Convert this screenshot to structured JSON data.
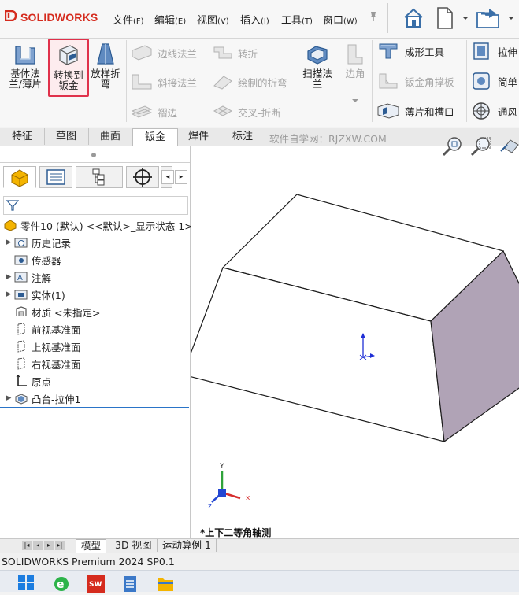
{
  "app": {
    "logo_text": "SOLIDWORKS",
    "brand_color": "#d52b1e"
  },
  "menus": [
    {
      "label": "文件",
      "key": "(F)"
    },
    {
      "label": "编辑",
      "key": "(E)"
    },
    {
      "label": "视图",
      "key": "(V)"
    },
    {
      "label": "插入",
      "key": "(I)"
    },
    {
      "label": "工具",
      "key": "(T)"
    },
    {
      "label": "窗口",
      "key": "(W)"
    }
  ],
  "ribbon": {
    "base_flange": "基体法\n兰/薄片",
    "convert_to_sheet_metal": "转换到\n钣金",
    "lofted_bend": "放样折\n弯",
    "edge_flange": "边线法兰",
    "jog": "转折",
    "miter_flange": "斜接法兰",
    "sketched_bend": "绘制的折弯",
    "hem": "褶边",
    "cross_break": "交叉-折断",
    "swept_flange": "扫描法\n兰",
    "corner": "边角",
    "forming_tool": "成形工具",
    "sheet_metal_gusset": "钣金角撑板",
    "tab_and_slot": "薄片和槽口",
    "extrude": "拉伸",
    "simple": "简单",
    "vent": "通风"
  },
  "tabs": [
    "特征",
    "草图",
    "曲面",
    "钣金",
    "焊件",
    "标注"
  ],
  "active_tab": "钣金",
  "watermark": "软件自学网：RJZXW.COM",
  "tree": {
    "root": "零件10 (默认) <<默认>_显示状态 1>",
    "items": [
      {
        "label": "历史记录",
        "expandable": true
      },
      {
        "label": "传感器",
        "expandable": false
      },
      {
        "label": "注解",
        "expandable": true
      },
      {
        "label": "实体(1)",
        "expandable": true
      },
      {
        "label": "材质 <未指定>",
        "expandable": false
      },
      {
        "label": "前视基准面",
        "expandable": false
      },
      {
        "label": "上视基准面",
        "expandable": false
      },
      {
        "label": "右视基准面",
        "expandable": false
      },
      {
        "label": "原点",
        "expandable": false
      },
      {
        "label": "凸台-拉伸1",
        "expandable": true
      }
    ]
  },
  "viewport": {
    "view_label": "*上下二等角轴测",
    "triad": {
      "x": "x",
      "y": "Y",
      "z": "z"
    }
  },
  "bottom_tabs": [
    "模型",
    "3D 视图",
    "运动算例 1"
  ],
  "status": "SOLIDWORKS Premium 2024 SP0.1",
  "colors": {
    "accent_red": "#e0314b",
    "side_face": "#b0a3b6",
    "highlight_blue": "#2a74c8"
  }
}
